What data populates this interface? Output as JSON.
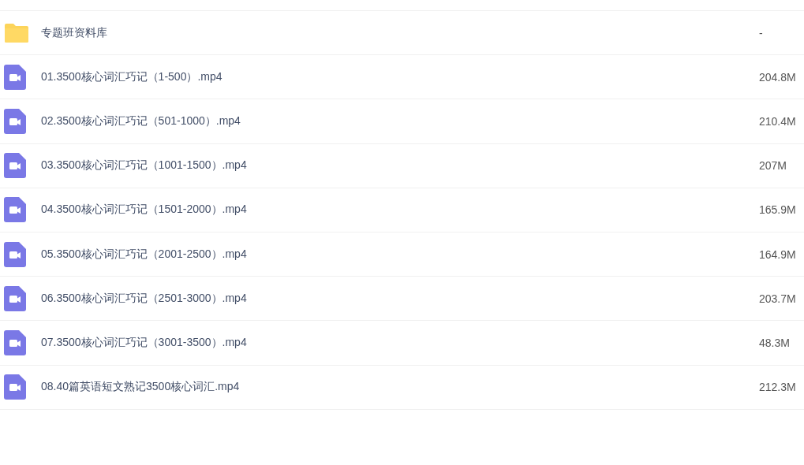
{
  "files": [
    {
      "kind": "folder",
      "name": "专题班资料库",
      "size": "-"
    },
    {
      "kind": "video",
      "name": "01.3500核心词汇巧记（1-500）.mp4",
      "size": "204.8M"
    },
    {
      "kind": "video",
      "name": "02.3500核心词汇巧记（501-1000）.mp4",
      "size": "210.4M"
    },
    {
      "kind": "video",
      "name": "03.3500核心词汇巧记（1001-1500）.mp4",
      "size": "207M"
    },
    {
      "kind": "video",
      "name": "04.3500核心词汇巧记（1501-2000）.mp4",
      "size": "165.9M"
    },
    {
      "kind": "video",
      "name": "05.3500核心词汇巧记（2001-2500）.mp4",
      "size": "164.9M"
    },
    {
      "kind": "video",
      "name": "06.3500核心词汇巧记（2501-3000）.mp4",
      "size": "203.7M"
    },
    {
      "kind": "video",
      "name": "07.3500核心词汇巧记（3001-3500）.mp4",
      "size": "48.3M"
    },
    {
      "kind": "video",
      "name": "08.40篇英语短文熟记3500核心词汇.mp4",
      "size": "212.3M"
    }
  ]
}
